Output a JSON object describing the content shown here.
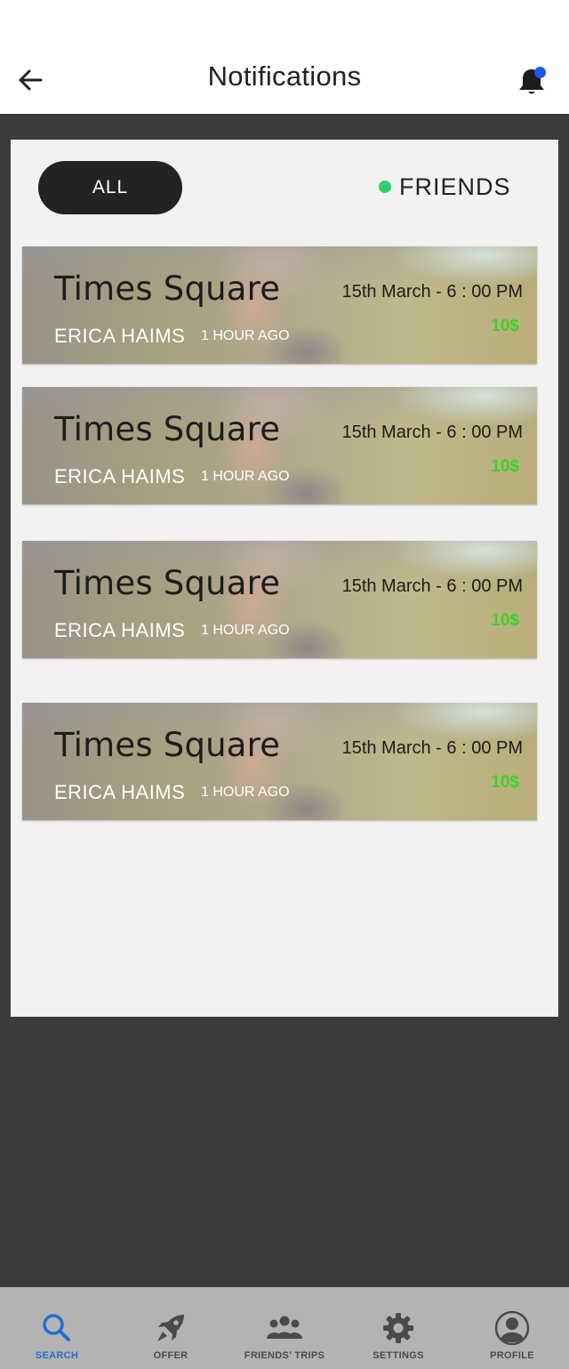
{
  "header": {
    "title": "Notifications",
    "back_icon": "arrow-left-icon",
    "bell_icon": "bell-icon",
    "bell_dot_color": "#1f5ae6"
  },
  "filters": {
    "all_label": "ALL",
    "friends_label": "FRIENDS",
    "friends_dot_color": "#2fd06b"
  },
  "notifications": [
    {
      "place": "Times Square",
      "name": "ERICA HAIMS",
      "time_ago": "1 HOUR AGO",
      "date": "15th March - 6 : 00 PM",
      "price": "10$"
    },
    {
      "place": "Times Square",
      "name": "ERICA HAIMS",
      "time_ago": "1 HOUR AGO",
      "date": "15th March - 6 : 00 PM",
      "price": "10$"
    },
    {
      "place": "Times Square",
      "name": "ERICA HAIMS",
      "time_ago": "1 HOUR AGO",
      "date": "15th March - 6 : 00 PM",
      "price": "10$"
    },
    {
      "place": "Times Square",
      "name": "ERICA HAIMS",
      "time_ago": "1 HOUR AGO",
      "date": "15th March - 6 : 00 PM",
      "price": "10$"
    }
  ],
  "colors": {
    "price": "#3fd12a",
    "nav_active": "#1f6fd0",
    "nav_inactive": "#4a4a4a"
  },
  "bottom_nav": [
    {
      "label": "SEARCH",
      "icon": "search-icon",
      "active": true
    },
    {
      "label": "OFFER",
      "icon": "rocket-icon",
      "active": false
    },
    {
      "label": "FRIENDS’ TRIPS",
      "icon": "group-icon",
      "active": false
    },
    {
      "label": "SETTINGS",
      "icon": "gear-icon",
      "active": false
    },
    {
      "label": "PROFILE",
      "icon": "user-icon",
      "active": false
    }
  ]
}
